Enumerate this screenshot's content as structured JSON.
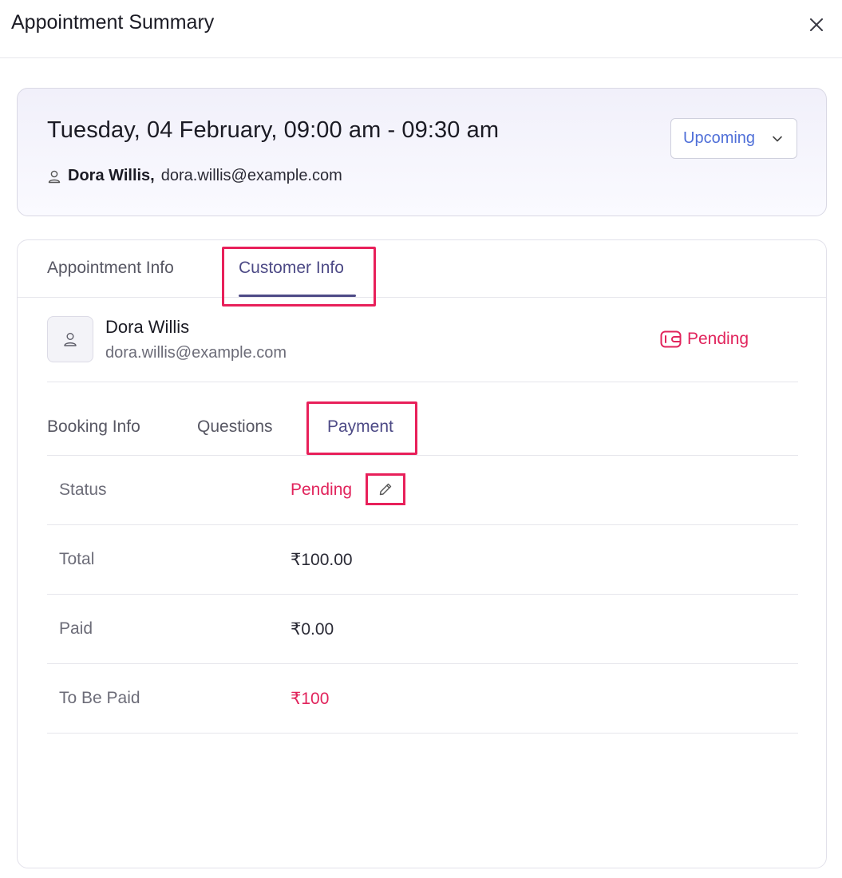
{
  "modal": {
    "title": "Appointment Summary"
  },
  "appointment": {
    "datetime": "Tuesday, 04 February, 09:00 am - 09:30 am",
    "customer_name": "Dora Willis,",
    "customer_email": "dora.willis@example.com",
    "status_label": "Upcoming"
  },
  "tabs": [
    {
      "label": "Appointment Info",
      "active": false
    },
    {
      "label": "Customer Info",
      "active": true
    }
  ],
  "customer": {
    "name": "Dora Willis",
    "email": "dora.willis@example.com",
    "payment_status": "Pending"
  },
  "subtabs": [
    {
      "label": "Booking Info",
      "active": false
    },
    {
      "label": "Questions",
      "active": false
    },
    {
      "label": "Payment",
      "active": true
    }
  ],
  "payment": {
    "rows": [
      {
        "label": "Status",
        "value": "Pending"
      },
      {
        "label": "Total",
        "value": "₹100.00"
      },
      {
        "label": "Paid",
        "value": "₹0.00"
      },
      {
        "label": "To Be Paid",
        "value": "₹100"
      }
    ]
  },
  "colors": {
    "accent": "#4d4a86",
    "link_blue": "#4f6fd8",
    "pending_red": "#e1245c",
    "highlight": "#e8205a"
  }
}
